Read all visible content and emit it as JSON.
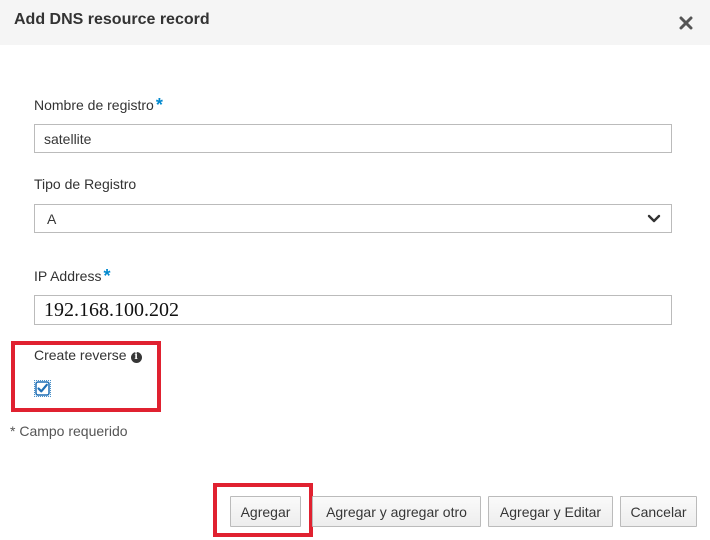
{
  "dialog": {
    "title": "Add DNS resource record",
    "close_icon": "close-icon"
  },
  "form": {
    "record_name": {
      "label": "Nombre de registro",
      "required_mark": "*",
      "value": "satellite"
    },
    "record_type": {
      "label": "Tipo de Registro",
      "value": "A"
    },
    "ip_address": {
      "label": "IP Address",
      "required_mark": "*",
      "value": "192.168.100.202"
    },
    "create_reverse": {
      "label": "Create reverse",
      "info_icon": "info-icon",
      "checked": true
    },
    "required_note": "* Campo requerido"
  },
  "buttons": {
    "add": "Agregar",
    "add_another": "Agregar y agregar otro",
    "add_edit": "Agregar y Editar",
    "cancel": "Cancelar"
  },
  "colors": {
    "required": "#0088ce",
    "highlight": "#e02130",
    "checkbox": "#1f6fb5"
  }
}
